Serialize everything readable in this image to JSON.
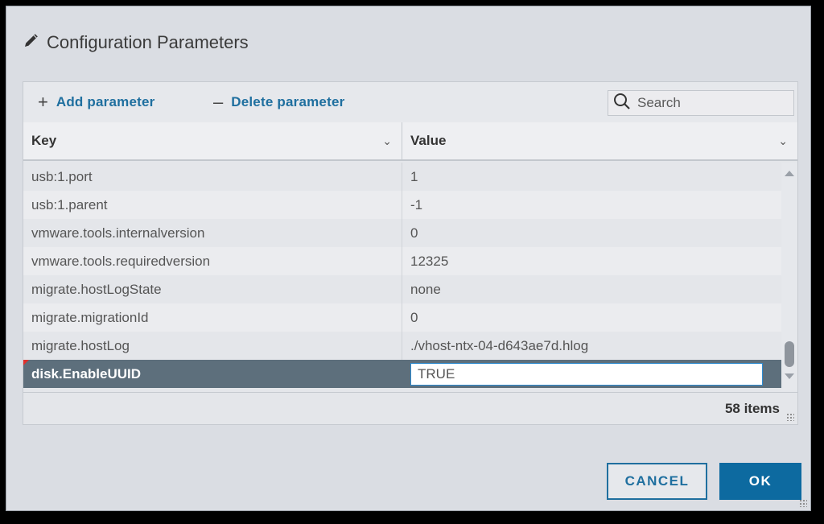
{
  "dialog": {
    "title": "Configuration Parameters",
    "title_icon": "pencil-icon"
  },
  "toolbar": {
    "add": {
      "glyph": "+",
      "label": "Add parameter",
      "icon": "plus-icon"
    },
    "delete": {
      "glyph": "–",
      "label": "Delete parameter",
      "icon": "minus-icon"
    },
    "search": {
      "placeholder": "Search",
      "value": "",
      "icon": "search-icon"
    }
  },
  "table": {
    "columns": [
      {
        "label": "Key",
        "icon": "chevron-down-icon"
      },
      {
        "label": "Value",
        "icon": "chevron-down-icon"
      }
    ],
    "rows": [
      {
        "key": "usb:1.port",
        "value": "1"
      },
      {
        "key": "usb:1.parent",
        "value": "-1"
      },
      {
        "key": "vmware.tools.internalversion",
        "value": "0"
      },
      {
        "key": "vmware.tools.requiredversion",
        "value": "12325"
      },
      {
        "key": "migrate.hostLogState",
        "value": "none"
      },
      {
        "key": "migrate.migrationId",
        "value": "0"
      },
      {
        "key": "migrate.hostLog",
        "value": "./vhost-ntx-04-d643ae7d.hlog"
      }
    ],
    "selected_row": {
      "key": "disk.EnableUUID",
      "value": "TRUE"
    },
    "item_count": "58 items"
  },
  "buttons": {
    "cancel": "CANCEL",
    "ok": "OK"
  },
  "colors": {
    "accent": "#1f6f9f",
    "primary_button": "#0d6aa0",
    "selected_row": "#5d6f7c",
    "edit_marker": "#e0312d"
  }
}
